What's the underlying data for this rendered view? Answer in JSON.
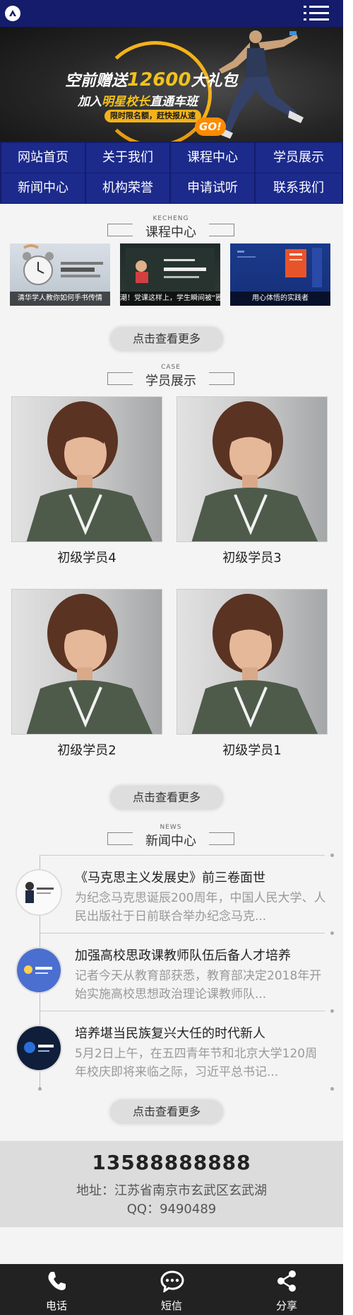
{
  "header": {
    "logo_icon": "logo-mark-icon",
    "menu_icon": "hamburger-menu-icon",
    "bar_color": "#141c6b"
  },
  "banner": {
    "line1_prefix": "空前赠送",
    "line1_number": "12600",
    "line1_suffix": "大礼包",
    "line2_prefix": "加入",
    "line2_highlight": "明星校长",
    "line2_suffix": "直通车班",
    "pill": "限时限名额，赶快报从速",
    "go": "GO!"
  },
  "nav": {
    "items": [
      "网站首页",
      "关于我们",
      "课程中心",
      "学员展示",
      "新闻中心",
      "机构荣誉",
      "申请试听",
      "联系我们"
    ]
  },
  "courses_section": {
    "title_en": "KECHENG",
    "title_cn": "课程中心",
    "items": [
      {
        "caption": "清华学人教你如何手书传情"
      },
      {
        "caption": "潮！党课这样上，学生瞬间被“圈..."
      },
      {
        "caption": "用心体悟的实践者"
      }
    ],
    "more": "点击查看更多"
  },
  "students_section": {
    "title_en": "CASE",
    "title_cn": "学员展示",
    "items": [
      {
        "name": "初级学员4"
      },
      {
        "name": "初级学员3"
      },
      {
        "name": "初级学员2"
      },
      {
        "name": "初级学员1"
      }
    ],
    "more": "点击查看更多"
  },
  "news_section": {
    "title_en": "NEWS",
    "title_cn": "新闻中心",
    "items": [
      {
        "title": "《马克思主义发展史》前三卷面世",
        "desc": "为纪念马克思诞辰200周年，中国人民大学、人民出版社于日前联合举办纪念马克..."
      },
      {
        "title": "加强高校思政课教师队伍后备人才培养",
        "desc": "记者今天从教育部获悉，教育部决定2018年开始实施高校思想政治理论课教师队..."
      },
      {
        "title": "培养堪当民族复兴大任的时代新人",
        "desc": "5月2日上午，在五四青年节和北京大学120周年校庆即将来临之际，习近平总书记..."
      }
    ],
    "more": "点击查看更多"
  },
  "contact": {
    "phone": "13588888888",
    "address": "地址：江苏省南京市玄武区玄武湖",
    "qq": "QQ：9490489"
  },
  "bottombar": {
    "items": [
      {
        "label": "电话",
        "icon": "phone-icon"
      },
      {
        "label": "短信",
        "icon": "message-icon"
      },
      {
        "label": "分享",
        "icon": "share-icon"
      }
    ]
  }
}
